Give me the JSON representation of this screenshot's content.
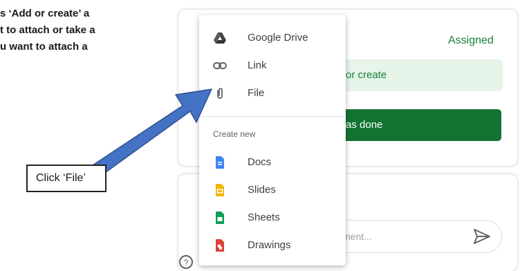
{
  "instruction": {
    "line1": "s ‘Add or create’ a",
    "line2": "t to attach or take a",
    "line3": "u want to attach a"
  },
  "assignment": {
    "status": "Assigned",
    "add_button": "or create",
    "done_button": "as done",
    "comment_placeholder": "ment..."
  },
  "menu": {
    "items": [
      {
        "label": "Google Drive",
        "icon": "google-drive-icon"
      },
      {
        "label": "Link",
        "icon": "link-icon"
      },
      {
        "label": "File",
        "icon": "paperclip-icon"
      }
    ],
    "section_label": "Create new",
    "create_items": [
      {
        "label": "Docs",
        "icon": "docs-icon",
        "color": "#4285f4"
      },
      {
        "label": "Slides",
        "icon": "slides-icon",
        "color": "#f4b400"
      },
      {
        "label": "Sheets",
        "icon": "sheets-icon",
        "color": "#0f9d58"
      },
      {
        "label": "Drawings",
        "icon": "drawings-icon",
        "color": "#db4437"
      }
    ]
  },
  "callout": {
    "text": "Click ‘File’"
  },
  "colors": {
    "accent_green": "#188038",
    "dark_green": "#137333",
    "light_green": "#e6f4ea",
    "arrow_blue": "#4472c4"
  }
}
